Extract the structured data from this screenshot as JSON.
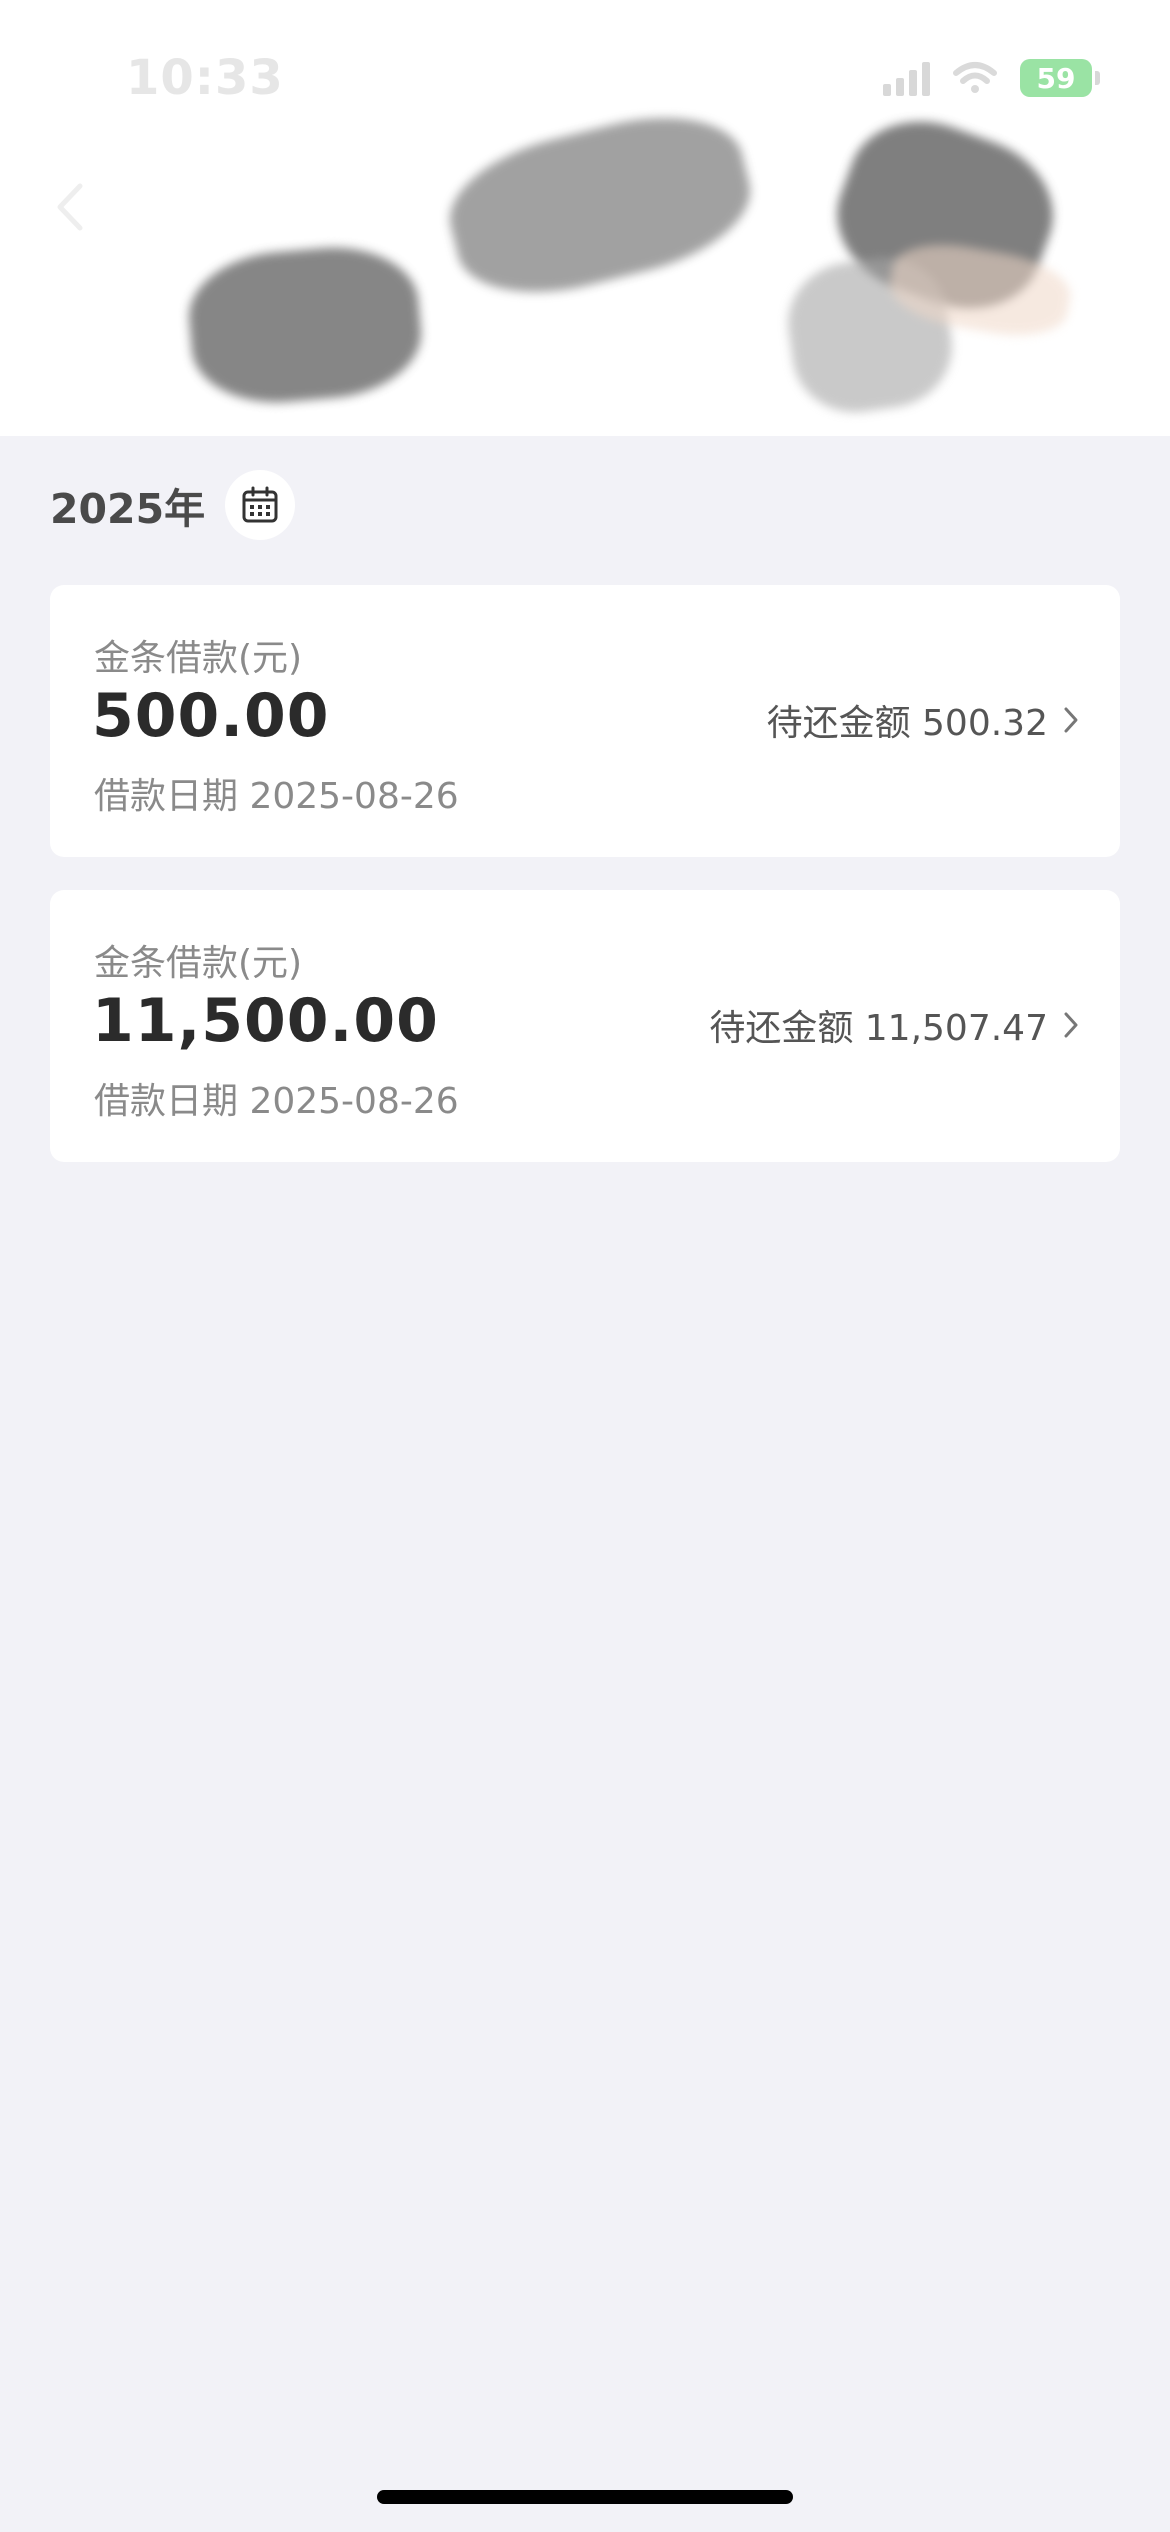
{
  "status_bar": {
    "time": "10:33",
    "battery": "59"
  },
  "header": {
    "back_icon": "chevron-left-icon"
  },
  "filter": {
    "year": "2025年",
    "calendar_icon": "calendar-icon"
  },
  "loans": [
    {
      "title": "金条借款(元)",
      "amount": "500.00",
      "date": "借款日期 2025-08-26",
      "due": "待还金额 500.32"
    },
    {
      "title": "金条借款(元)",
      "amount": "11,500.00",
      "date": "借款日期 2025-08-26",
      "due": "待还金额 11,507.47"
    }
  ],
  "colors": {
    "background": "#f2f2f7",
    "card": "#ffffff",
    "battery": "#9ae3a4"
  }
}
